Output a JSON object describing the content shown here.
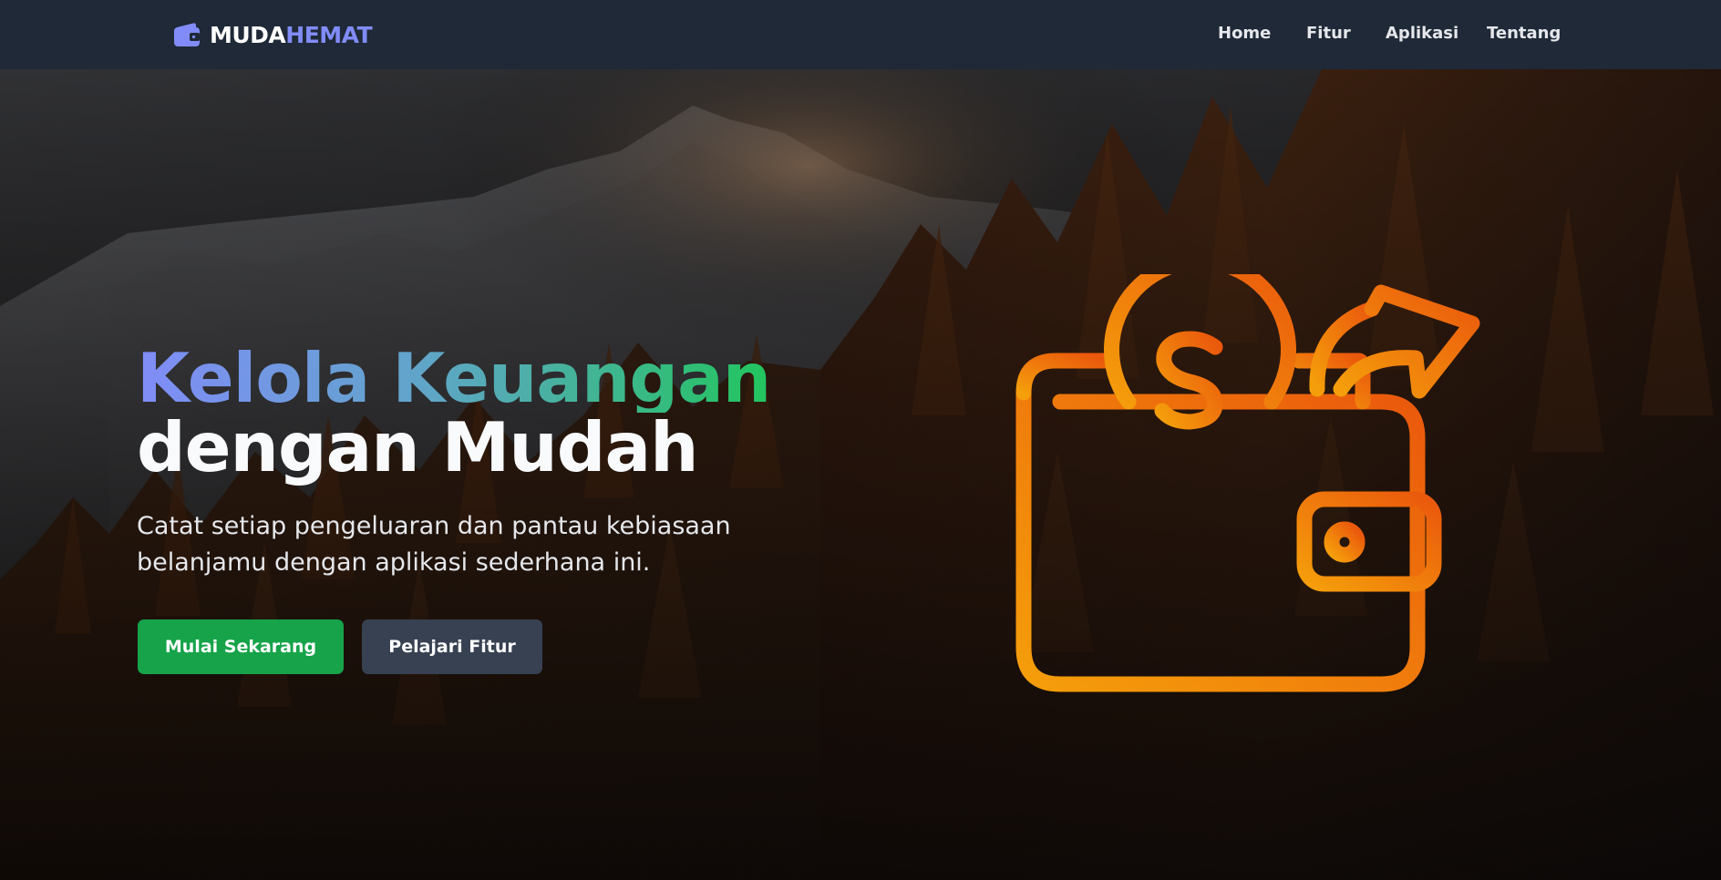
{
  "brand": {
    "name_part1": "MUDA",
    "name_part2": "HEMAT",
    "icon": "wallet-icon",
    "accent_color": "#818cf8"
  },
  "nav": {
    "items": [
      {
        "label": "Home"
      },
      {
        "label": "Fitur"
      },
      {
        "label": "Aplikasi"
      },
      {
        "label": "Tentang"
      }
    ]
  },
  "hero": {
    "title_line1": "Kelola Keuangan",
    "title_line2": "dengan Mudah",
    "subtitle": "Catat setiap pengeluaran dan pantau kebiasaan belanjamu dengan aplikasi sederhana ini.",
    "primary_button": "Mulai Sekarang",
    "secondary_button": "Pelajari Fitur",
    "illustration_icon": "wallet-money-growth-icon",
    "background": "autumn-forest-mountain-photo",
    "colors": {
      "primary_button": "#16a34a",
      "secondary_button": "#374151",
      "illustration_gradient_start": "#f59e0b",
      "illustration_gradient_end": "#ea580c"
    }
  }
}
